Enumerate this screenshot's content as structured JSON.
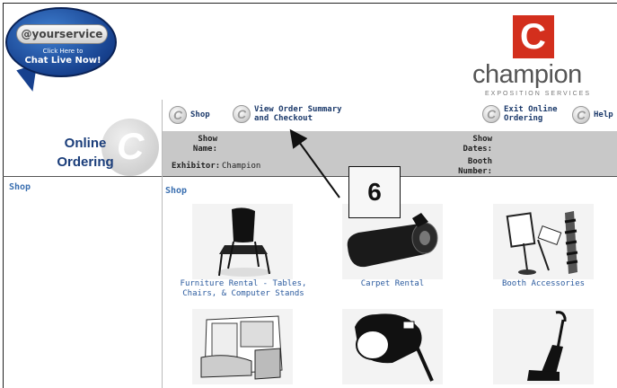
{
  "chat": {
    "pill": "@yourservice",
    "small": "Click Here to",
    "big": "Chat Live Now!"
  },
  "logo": {
    "letter": "C",
    "word": "champion",
    "sub": "EXPOSITION SERVICES"
  },
  "nav": {
    "shop": "Shop",
    "view_order_line1": "View Order Summary",
    "view_order_line2": "and Checkout",
    "exit_line1": "Exit Online",
    "exit_line2": "Ordering",
    "help": "Help"
  },
  "header": {
    "title_line1": "Online",
    "title_line2": "Ordering",
    "show_name_label_1": "Show",
    "show_name_label_2": "Name:",
    "show_dates_label_1": "Show",
    "show_dates_label_2": "Dates:",
    "exhibitor_label": "Exhibitor:",
    "exhibitor_value": "Champion",
    "booth_label_1": "Booth",
    "booth_label_2": "Number:"
  },
  "sidebar": {
    "shop": "Shop"
  },
  "main": {
    "title": "Shop",
    "tiles": [
      {
        "label_1": "Furniture Rental - Tables,",
        "label_2": "Chairs, & Computer Stands"
      },
      {
        "label_1": "Carpet Rental",
        "label_2": ""
      },
      {
        "label_1": "Booth Accessories",
        "label_2": ""
      },
      {
        "label_1": "",
        "label_2": ""
      },
      {
        "label_1": "",
        "label_2": ""
      },
      {
        "label_1": "",
        "label_2": ""
      }
    ]
  },
  "callout": "6"
}
